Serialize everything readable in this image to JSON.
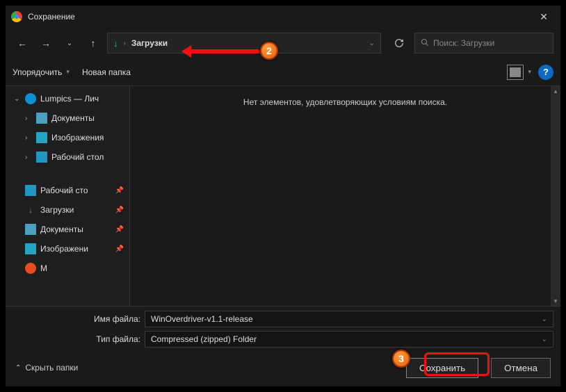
{
  "window": {
    "title": "Сохранение"
  },
  "nav": {
    "address_text": "Загрузки",
    "search_placeholder": "Поиск: Загрузки"
  },
  "toolbar": {
    "organize": "Упорядочить",
    "new_folder": "Новая папка"
  },
  "sidebar": {
    "onedrive": "Lumpics — Лич",
    "documents": "Документы",
    "images": "Изображения",
    "desktop": "Рабочий стол",
    "pinned_desktop": "Рабочий сто",
    "pinned_downloads": "Загрузки",
    "pinned_documents": "Документы",
    "pinned_images": "Изображени",
    "pinned_m": "М"
  },
  "content": {
    "empty_message": "Нет элементов, удовлетворяющих условиям поиска."
  },
  "form": {
    "filename_label": "Имя файла:",
    "filename_value": "WinOverdriver-v1.1-release",
    "filetype_label": "Тип файла:",
    "filetype_value": "Compressed (zipped) Folder"
  },
  "footer": {
    "hide_folders": "Скрыть папки",
    "save": "Сохранить",
    "cancel": "Отмена"
  },
  "annotations": {
    "badge2": "2",
    "badge3": "3"
  }
}
